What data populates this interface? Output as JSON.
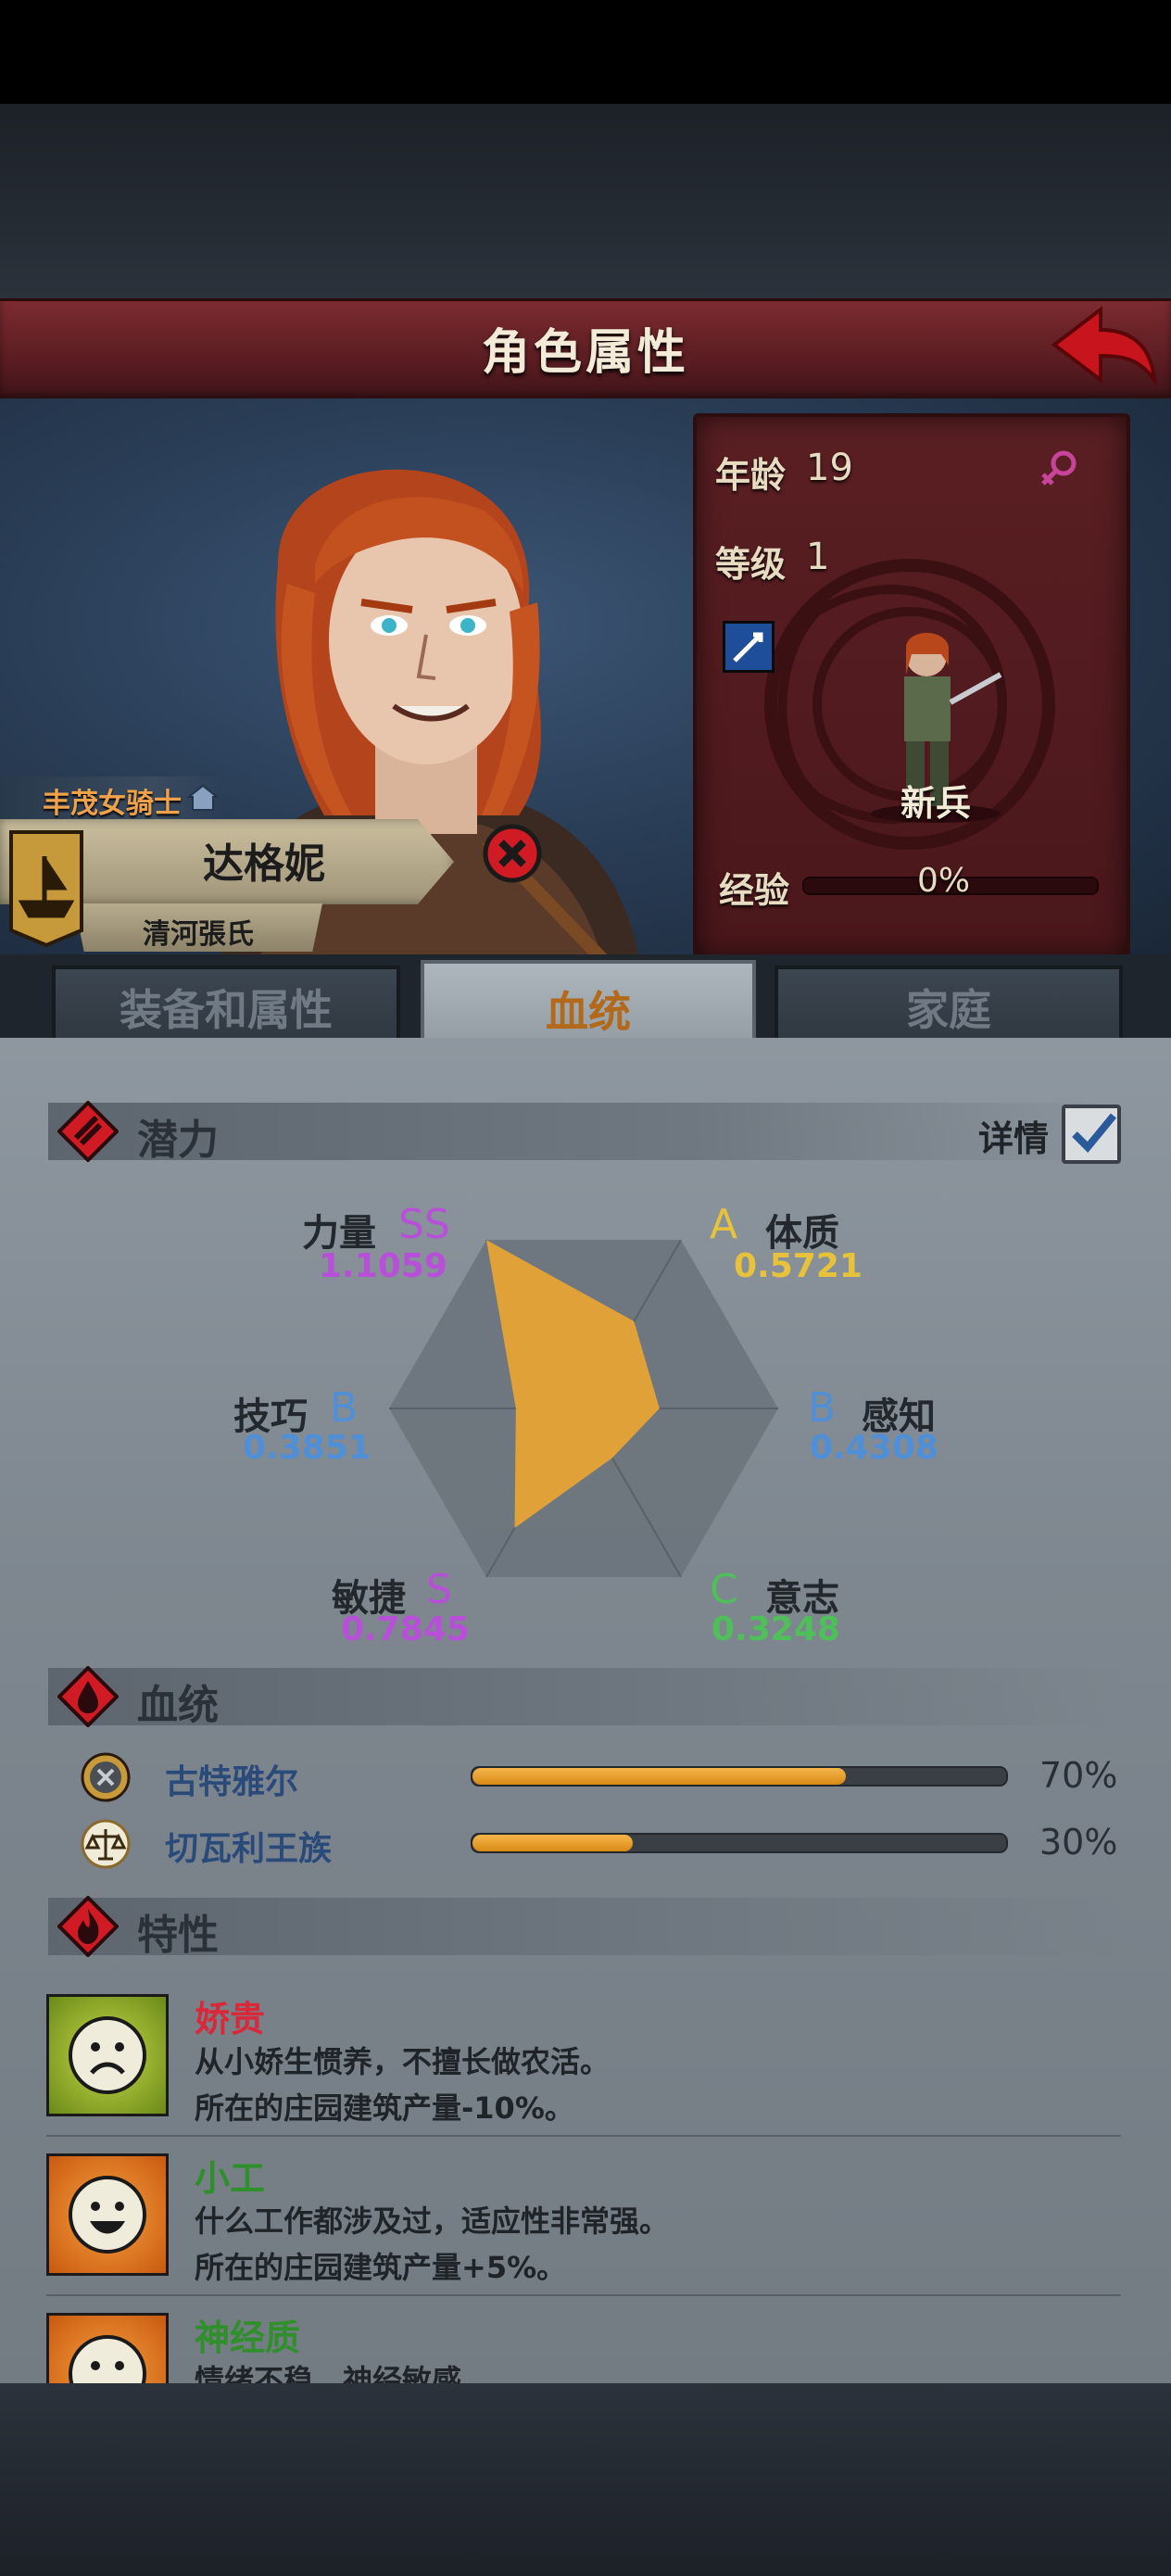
{
  "header": {
    "title": "角色属性"
  },
  "character": {
    "title": "丰茂女骑士",
    "name": "达格妮",
    "clan": "清河張氏"
  },
  "stats": {
    "age_label": "年龄",
    "age": "19",
    "level_label": "等级",
    "level": "1",
    "class_name": "新兵",
    "exp_label": "经验",
    "exp": "0%",
    "exp_progress": 0
  },
  "tabs": [
    {
      "label": "装备和属性",
      "active": false
    },
    {
      "label": "血统",
      "active": true
    },
    {
      "label": "家庭",
      "active": false
    }
  ],
  "potential": {
    "title": "潜力",
    "detail_label": "详情",
    "detail_checked": true,
    "attributes": [
      {
        "name": "力量",
        "grade": "SS",
        "value": "1.1059",
        "color": "#b84fd8"
      },
      {
        "name": "体质",
        "grade": "A",
        "value": "0.5721",
        "color": "#e8c23a"
      },
      {
        "name": "感知",
        "grade": "B",
        "value": "0.4308",
        "color": "#4f8fd8"
      },
      {
        "name": "意志",
        "grade": "C",
        "value": "0.3248",
        "color": "#4fbf5a"
      },
      {
        "name": "敏捷",
        "grade": "S",
        "value": "0.7845",
        "color": "#b84fd8"
      },
      {
        "name": "技巧",
        "grade": "B",
        "value": "0.3851",
        "color": "#4f8fd8"
      }
    ],
    "radar_fill": "#e0a238"
  },
  "bloodline": {
    "title": "血统",
    "items": [
      {
        "name": "古特雅尔",
        "percent": "70%",
        "fraction": 0.7
      },
      {
        "name": "切瓦利王族",
        "percent": "30%",
        "fraction": 0.3
      }
    ]
  },
  "traits": {
    "title": "特性",
    "items": [
      {
        "name": "娇贵",
        "name_color": "#d8283a",
        "desc1": "从小娇生惯养，不擅长做农活。",
        "desc2": "所在的庄园建筑产量-10%。",
        "icon": "sad-face-icon"
      },
      {
        "name": "小工",
        "name_color": "#2f8f2a",
        "desc1": "什么工作都涉及过，适应性非常强。",
        "desc2": "所在的庄园建筑产量+5%。",
        "icon": "happy-face-icon"
      },
      {
        "name": "神经质",
        "name_color": "#2f8f2a",
        "desc1": "情绪不稳，神经敏感",
        "desc2": "",
        "icon": "happy-face-icon"
      }
    ]
  }
}
